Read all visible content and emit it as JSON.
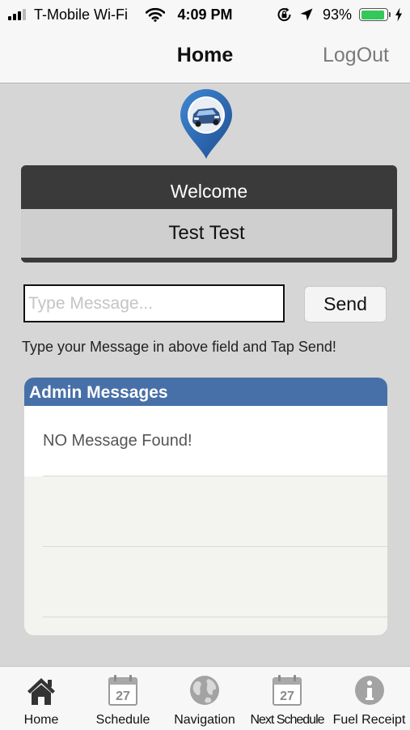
{
  "status_bar": {
    "carrier": "T-Mobile Wi-Fi",
    "time": "4:09 PM",
    "battery_percent": "93%",
    "battery_level": 0.93,
    "battery_color": "#34c759"
  },
  "nav": {
    "title": "Home",
    "logout_label": "LogOut"
  },
  "logo": {
    "icon": "car-location-pin-icon",
    "color": "#2f6fb9"
  },
  "welcome": {
    "label": "Welcome",
    "name": "Test Test"
  },
  "message": {
    "placeholder": "Type Message...",
    "value": "",
    "send_label": "Send",
    "hint": "Type your Message in above field and Tap Send!"
  },
  "admin": {
    "title": "Admin Messages",
    "header_color": "#4870a8",
    "empty_text": "NO Message Found!"
  },
  "tabs": [
    {
      "label": "Home",
      "icon": "home-icon"
    },
    {
      "label": "Schedule",
      "icon": "calendar-icon",
      "day": "27"
    },
    {
      "label": "Navigation",
      "icon": "globe-icon"
    },
    {
      "label": "Next Schedule",
      "icon": "calendar-icon",
      "day": "27"
    },
    {
      "label": "Fuel Receipt",
      "icon": "info-icon"
    }
  ]
}
